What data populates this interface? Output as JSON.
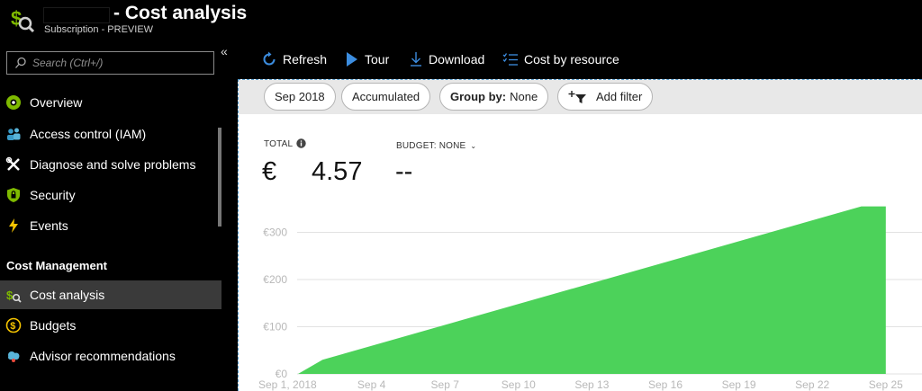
{
  "header": {
    "title": "- Cost analysis",
    "subtitle": "Subscription - PREVIEW"
  },
  "sidebar": {
    "search_placeholder": "Search (Ctrl+/)",
    "items": [
      {
        "label": "Overview",
        "icon": "overview-icon"
      },
      {
        "label": "Access control (IAM)",
        "icon": "people-icon"
      },
      {
        "label": "Diagnose and solve problems",
        "icon": "wrench-icon"
      },
      {
        "label": "Security",
        "icon": "shield-icon"
      },
      {
        "label": "Events",
        "icon": "lightning-icon"
      }
    ],
    "section_title": "Cost Management",
    "cm_items": [
      {
        "label": "Cost analysis",
        "icon": "cost-analysis-icon",
        "active": true
      },
      {
        "label": "Budgets",
        "icon": "budget-icon"
      },
      {
        "label": "Advisor recommendations",
        "icon": "advisor-cloud-icon"
      }
    ]
  },
  "toolbar": {
    "refresh": "Refresh",
    "tour": "Tour",
    "download": "Download",
    "cost_by_resource": "Cost by resource"
  },
  "filters": {
    "period": "Sep 2018",
    "view": "Accumulated",
    "group_by_label": "Group by:",
    "group_by_value": "None",
    "add_filter": "Add filter"
  },
  "kpis": {
    "total_label": "TOTAL",
    "currency": "€",
    "total_value": "4.57",
    "budget_label": "BUDGET: NONE",
    "budget_value": "--"
  },
  "colors": {
    "area_fill": "#4cd25a",
    "accent_blue": "#3c8de0"
  },
  "chart_data": {
    "type": "area",
    "y_ticks": [
      "€300",
      "€200",
      "€100",
      "€0"
    ],
    "y_tick_values": [
      300,
      200,
      100,
      0
    ],
    "x_ticks": [
      "Sep 1, 2018",
      "Sep 4",
      "Sep 7",
      "Sep 10",
      "Sep 13",
      "Sep 16",
      "Sep 19",
      "Sep 22",
      "Sep 25"
    ],
    "x_tick_days": [
      1,
      4,
      7,
      10,
      13,
      16,
      19,
      22,
      25
    ],
    "ylim": [
      0,
      300
    ],
    "xlim": [
      1,
      26
    ],
    "grid": true,
    "series": [
      {
        "x": [
          1,
          2,
          24,
          25
        ],
        "y": [
          0,
          30,
          355,
          355
        ]
      }
    ]
  }
}
